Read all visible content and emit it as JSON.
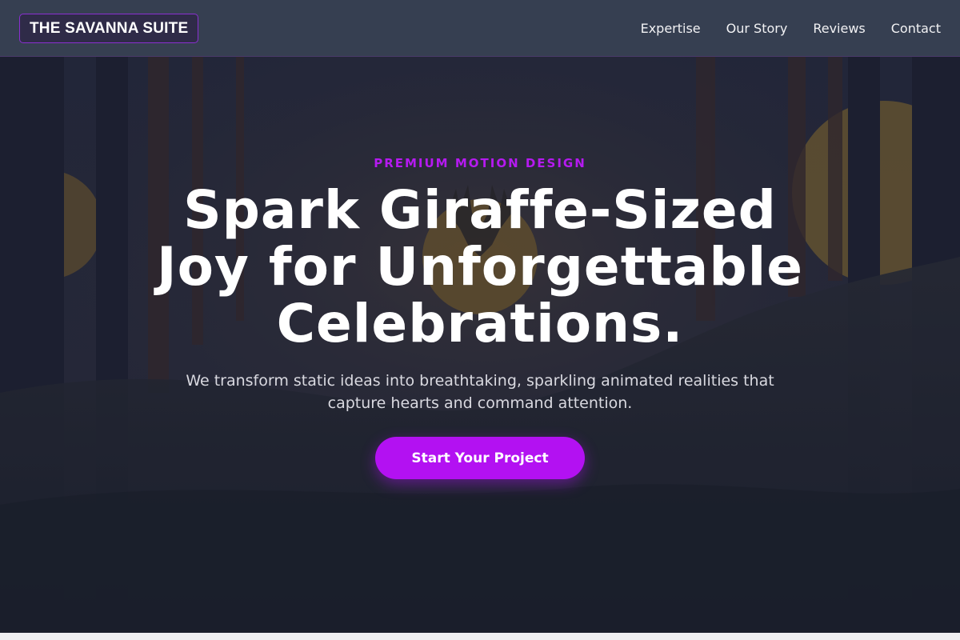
{
  "nav": {
    "logo": "THE SAVANNA SUITE",
    "links": [
      "Expertise",
      "Our Story",
      "Reviews",
      "Contact"
    ]
  },
  "hero": {
    "eyebrow": "PREMIUM MOTION DESIGN",
    "headline": "Spark Giraffe-Sized Joy for Unforgettable Celebrations.",
    "subtitle": "We transform static ideas into breathtaking, sparkling animated realities that capture hearts and command attention.",
    "cta_label": "Start Your Project",
    "background_image": "dark-forest-sunset-with-deer-emblem"
  },
  "colors": {
    "nav_bg": "#363f51",
    "logo_border": "#8a2fd0",
    "accent": "#b311f2",
    "hero_bg": "#1c2233",
    "text_light": "#ffffff",
    "text_muted": "#d9d9e0"
  }
}
